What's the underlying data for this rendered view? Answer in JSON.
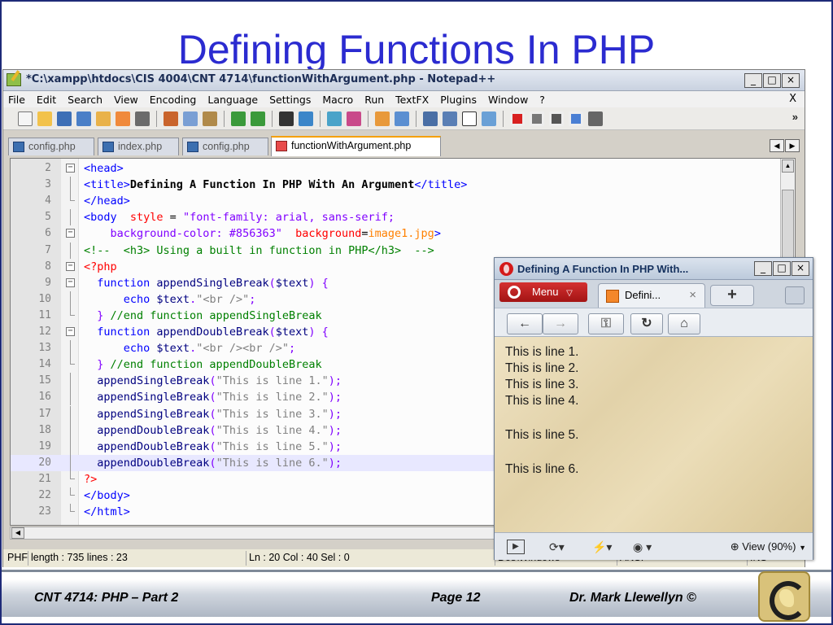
{
  "slide": {
    "title": "Defining Functions In PHP",
    "footer_left": "CNT 4714:  PHP – Part 2",
    "footer_center": "Page 12",
    "footer_right": "Dr. Mark Llewellyn ©"
  },
  "notepad": {
    "title": "*C:\\xampp\\htdocs\\CIS 4004\\CNT 4714\\functionWithArgument.php - Notepad++",
    "menu": [
      "File",
      "Edit",
      "Search",
      "View",
      "Encoding",
      "Language",
      "Settings",
      "Macro",
      "Run",
      "TextFX",
      "Plugins",
      "Window",
      "?"
    ],
    "menu_close": "X",
    "toolbar_more": "»",
    "tabs": [
      "config.php",
      "index.php",
      "config.php",
      "functionWithArgument.php"
    ],
    "line_numbers": [
      "2",
      "3",
      "4",
      "5",
      "6",
      "7",
      "8",
      "9",
      "10",
      "11",
      "12",
      "13",
      "14",
      "15",
      "16",
      "17",
      "18",
      "19",
      "20",
      "21",
      "22",
      "23"
    ],
    "code": [
      [
        "<head>"
      ],
      [
        "<title>",
        "Defining A Function In PHP With An Argument",
        "</title>"
      ],
      [
        "</head>"
      ],
      [
        "<body",
        "  style",
        " = ",
        "\"font-family: arial, sans-serif;"
      ],
      [
        "    background-color: #856363\"",
        "  background",
        "=",
        "image1.jpg",
        ">"
      ],
      [
        "<!--  <h3> Using a built in function in PHP</h3>  -->"
      ],
      [
        "<?php"
      ],
      [
        "  function",
        " appendSingleBreak",
        "(",
        "$text",
        ") {"
      ],
      [
        "      echo",
        " $text",
        ".",
        "\"<br />\"",
        ";"
      ],
      [
        "  }",
        " //end function appendSingleBreak"
      ],
      [
        "  function",
        " appendDoubleBreak",
        "(",
        "$text",
        ") {"
      ],
      [
        "      echo",
        " $text",
        ".",
        "\"<br /><br />\"",
        ";"
      ],
      [
        "  }",
        " //end function appendDoubleBreak"
      ],
      [
        "  appendSingleBreak",
        "(",
        "\"This is line 1.\"",
        ");"
      ],
      [
        "  appendSingleBreak",
        "(",
        "\"This is line 2.\"",
        ");"
      ],
      [
        "  appendSingleBreak",
        "(",
        "\"This is line 3.\"",
        ");"
      ],
      [
        "  appendDoubleBreak",
        "(",
        "\"This is line 4.\"",
        ");"
      ],
      [
        "  appendDoubleBreak",
        "(",
        "\"This is line 5.\"",
        ");"
      ],
      [
        "  appendDoubleBreak",
        "(",
        "\"This is line 6.\"",
        ");"
      ],
      [
        "?>"
      ],
      [
        "</body>"
      ],
      [
        "</html>"
      ]
    ],
    "current_line_index": 18,
    "status": {
      "doc_type": "PHF",
      "length": "length : 735   lines : 23",
      "position": "Ln : 20   Col : 40   Sel : 0",
      "eol": "Dos\\Windows",
      "encoding": "ANSI",
      "mode": "INS"
    }
  },
  "browser": {
    "title": "Defining A Function In PHP With...",
    "menu_label": "Menu",
    "tab_label": "Defini...",
    "tab_close": "×",
    "new_tab": "+",
    "nav": [
      "back-arrow",
      "forward-arrow",
      "key",
      "reload",
      "home"
    ],
    "lines": [
      "This is line 1.",
      "This is line 2.",
      "This is line 3.",
      "This is line 4.",
      "This is line 5.",
      "This is line 6."
    ],
    "zoom": "View (90%)"
  }
}
